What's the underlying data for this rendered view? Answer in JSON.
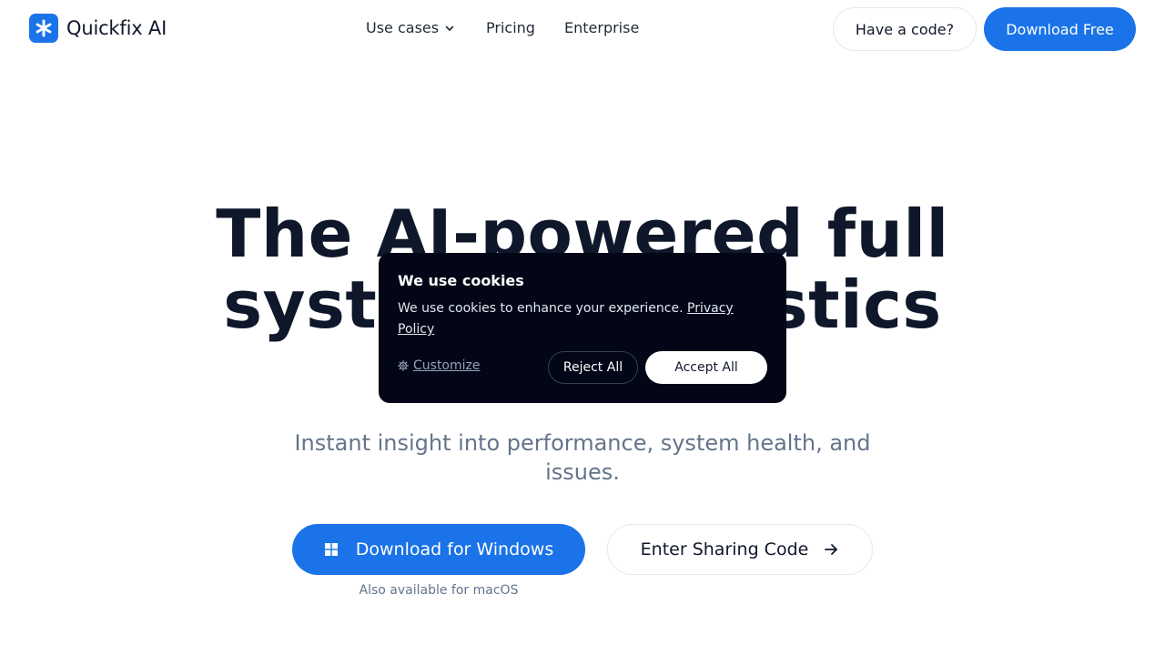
{
  "brand": {
    "name": "Quickfix AI",
    "accent": "#1a73e8",
    "logo_icon": "asterisk-icon"
  },
  "nav": {
    "items": [
      {
        "label": "Use cases",
        "icon": "chevron-down-icon"
      },
      {
        "label": "Pricing"
      },
      {
        "label": "Enterprise"
      }
    ]
  },
  "header_actions": {
    "code_label": "Have a code?",
    "download_label": "Download Free"
  },
  "hero": {
    "title_line1": "The AI-powered full",
    "title_line2": "system diagnostics",
    "subtitle": "Instant insight into performance, system health, and issues.",
    "primary_cta": {
      "label": "Download for Windows",
      "icon": "windows-icon"
    },
    "secondary_cta": {
      "label": "Enter Sharing Code",
      "icon": "arrow-right-icon"
    },
    "platform_note": "Also available for macOS"
  },
  "cookie_banner": {
    "title": "We use cookies",
    "text": "We use cookies to enhance your experience.",
    "link_label": "Privacy Policy",
    "customize_label": "Customize",
    "reject_label": "Reject All",
    "accept_label": "Accept All",
    "background": "#020617"
  }
}
